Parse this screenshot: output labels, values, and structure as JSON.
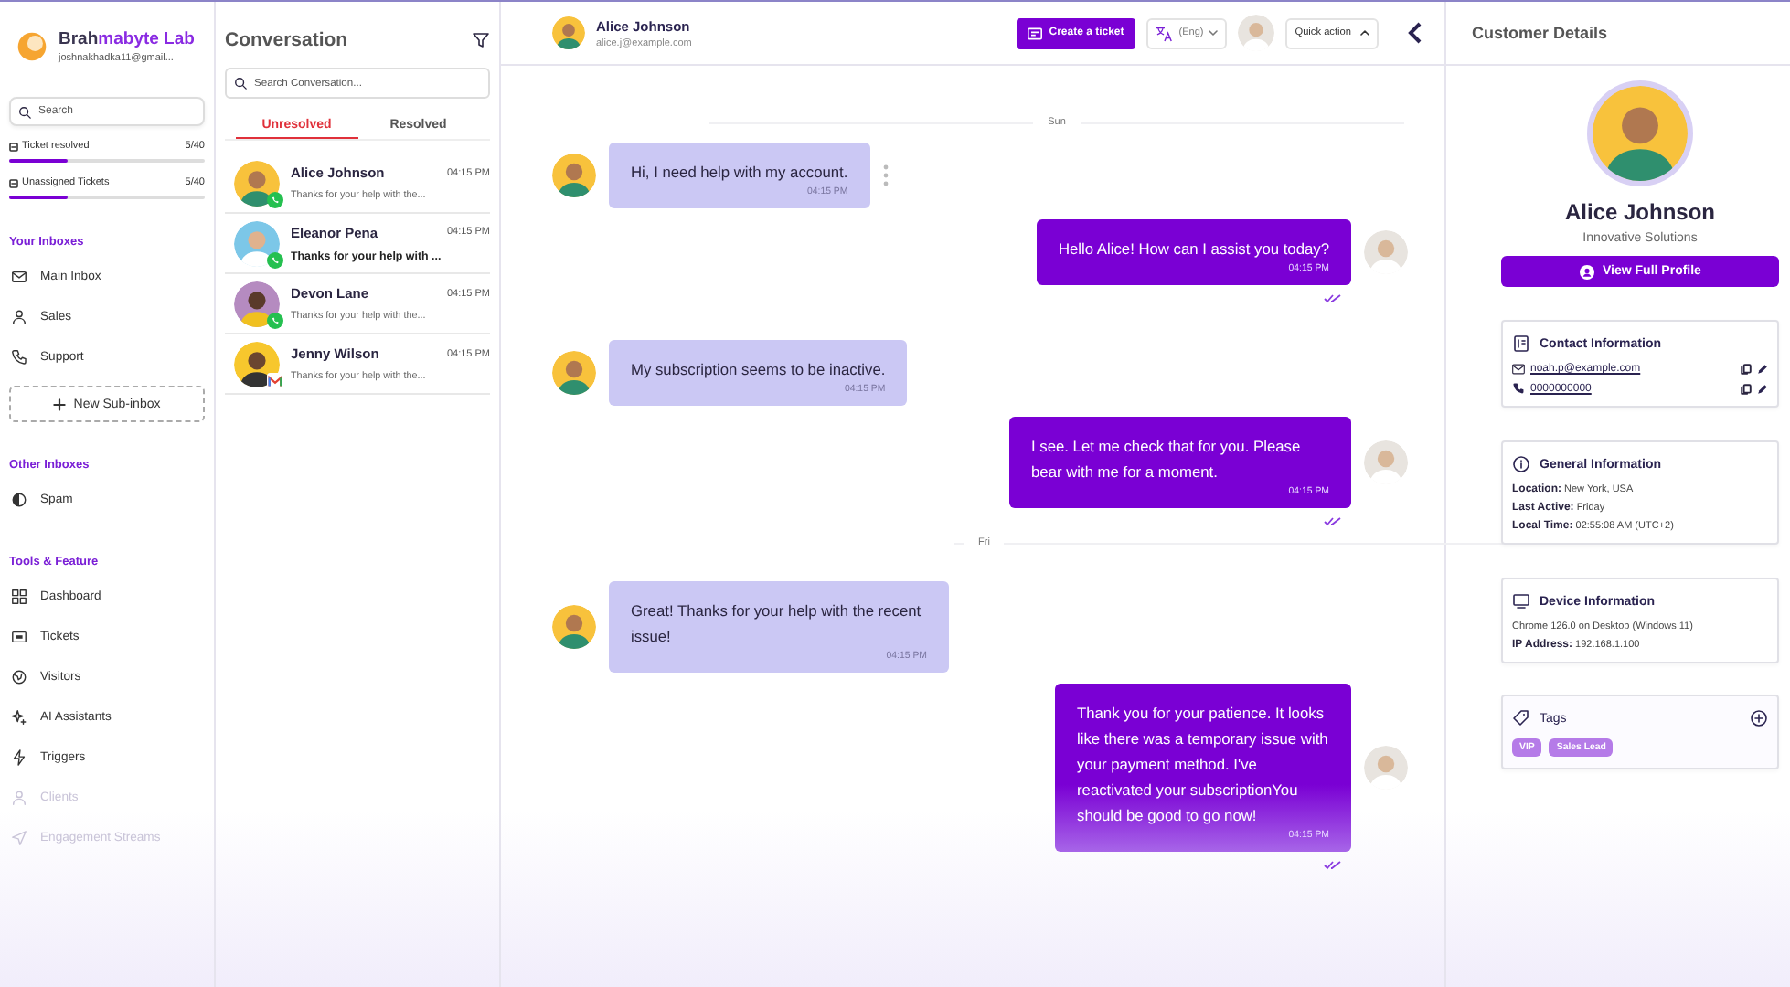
{
  "sidebar": {
    "brand": {
      "name": "Brah",
      "name_accent": "mabyte Lab",
      "email": "joshnakhadka11@gmail..."
    },
    "search": {
      "placeholder": "Search"
    },
    "stats": [
      {
        "label": "Ticket resolved",
        "count": "5/40",
        "level": 0.3
      },
      {
        "label": "Unassigned Tickets",
        "count": "5/40",
        "level": 0.3
      }
    ],
    "sections": [
      {
        "title": "Your Inboxes",
        "items": [
          {
            "label": "Main Inbox",
            "dimmed": false
          },
          {
            "label": "Sales",
            "dimmed": false
          },
          {
            "label": "Support",
            "dimmed": false
          }
        ],
        "action": "New Sub-inbox"
      },
      {
        "title": "Other Inboxes",
        "items": [
          {
            "label": "Spam",
            "dimmed": false
          }
        ]
      },
      {
        "title": "Tools & Feature",
        "items": [
          {
            "label": "Dashboard",
            "dimmed": false
          },
          {
            "label": "Tickets",
            "dimmed": false
          },
          {
            "label": "Visitors",
            "dimmed": false
          },
          {
            "label": "AI Assistants",
            "dimmed": false
          },
          {
            "label": "Triggers",
            "dimmed": false
          },
          {
            "label": "Clients",
            "dimmed": true
          },
          {
            "label": "Engagement Streams",
            "dimmed": true
          }
        ]
      }
    ]
  },
  "conversations": {
    "title": "Conversation",
    "search": {
      "placeholder": "Search Conversation..."
    },
    "tabs": [
      {
        "label": "Unresolved",
        "selected": true
      },
      {
        "label": "Resolved",
        "selected": false
      }
    ],
    "items": [
      {
        "name": "Alice Johnson",
        "time": "04:15 PM",
        "preview": "Thanks for your help with the...",
        "kind": "whatsapp",
        "unread": false
      },
      {
        "name": "Eleanor Pena",
        "time": "04:15 PM",
        "preview": "Thanks for your help with ...",
        "kind": "whatsapp",
        "unread": true
      },
      {
        "name": "Devon Lane",
        "time": "04:15 PM",
        "preview": "Thanks for your help with the...",
        "kind": "whatsapp",
        "unread": false
      },
      {
        "name": "Jenny Wilson",
        "time": "04:15 PM",
        "preview": "Thanks for your help with the...",
        "kind": "gmail",
        "unread": false
      }
    ]
  },
  "chat": {
    "contact": {
      "name": "Alice Johnson",
      "email": "alice.j@example.com"
    },
    "create_ticket": "Create a ticket",
    "language": "(Eng)",
    "quick_action": "Quick action",
    "messages": [
      {
        "kind": "divider",
        "text": "Sun"
      },
      {
        "kind": "incoming",
        "text": "Hi, I need help with my account.",
        "time": "04:15 PM"
      },
      {
        "kind": "outgoing",
        "text": "Hello Alice! How can I assist you today?",
        "time": "04:15 PM",
        "read": true
      },
      {
        "kind": "incoming",
        "text": "My subscription seems to be inactive.",
        "time": "04:15 PM"
      },
      {
        "kind": "outgoing",
        "text": "I see. Let me check that for you. Please bear with me for a moment.",
        "time": "04:15 PM",
        "read": true
      },
      {
        "kind": "divider",
        "text": "Fri"
      },
      {
        "kind": "incoming",
        "text": "Great! Thanks for your help with the recent issue!",
        "time": "04:15 PM"
      },
      {
        "kind": "outgoing",
        "text": "Thank you for your patience. It looks like there was a temporary issue with your payment method. I've reactivated your subscriptionYou should be good to go now!",
        "time": "04:15 PM",
        "read": true
      }
    ]
  },
  "customer": {
    "title": "Customer Details",
    "name": "Alice Johnson",
    "company": "Innovative Solutions",
    "profile_button": "View Full Profile",
    "contact": {
      "title": "Contact Information",
      "email": "noah.p@example.com",
      "phone": "0000000000"
    },
    "general": {
      "title": "General Information",
      "fields": [
        {
          "label": "Location:",
          "value": "New York, USA"
        },
        {
          "label": "Last Active:",
          "value": "Friday"
        },
        {
          "label": "Local Time:",
          "value": "02:55:08 AM (UTC+2)"
        }
      ]
    },
    "device": {
      "title": "Device Information",
      "summary": "Chrome 126.0 on Desktop (Windows 11)",
      "fields": [
        {
          "label": "IP Address:",
          "value": "192.168.1.100"
        }
      ]
    },
    "tags": {
      "title": "Tags",
      "items": [
        "VIP",
        "Sales Lead"
      ]
    }
  }
}
